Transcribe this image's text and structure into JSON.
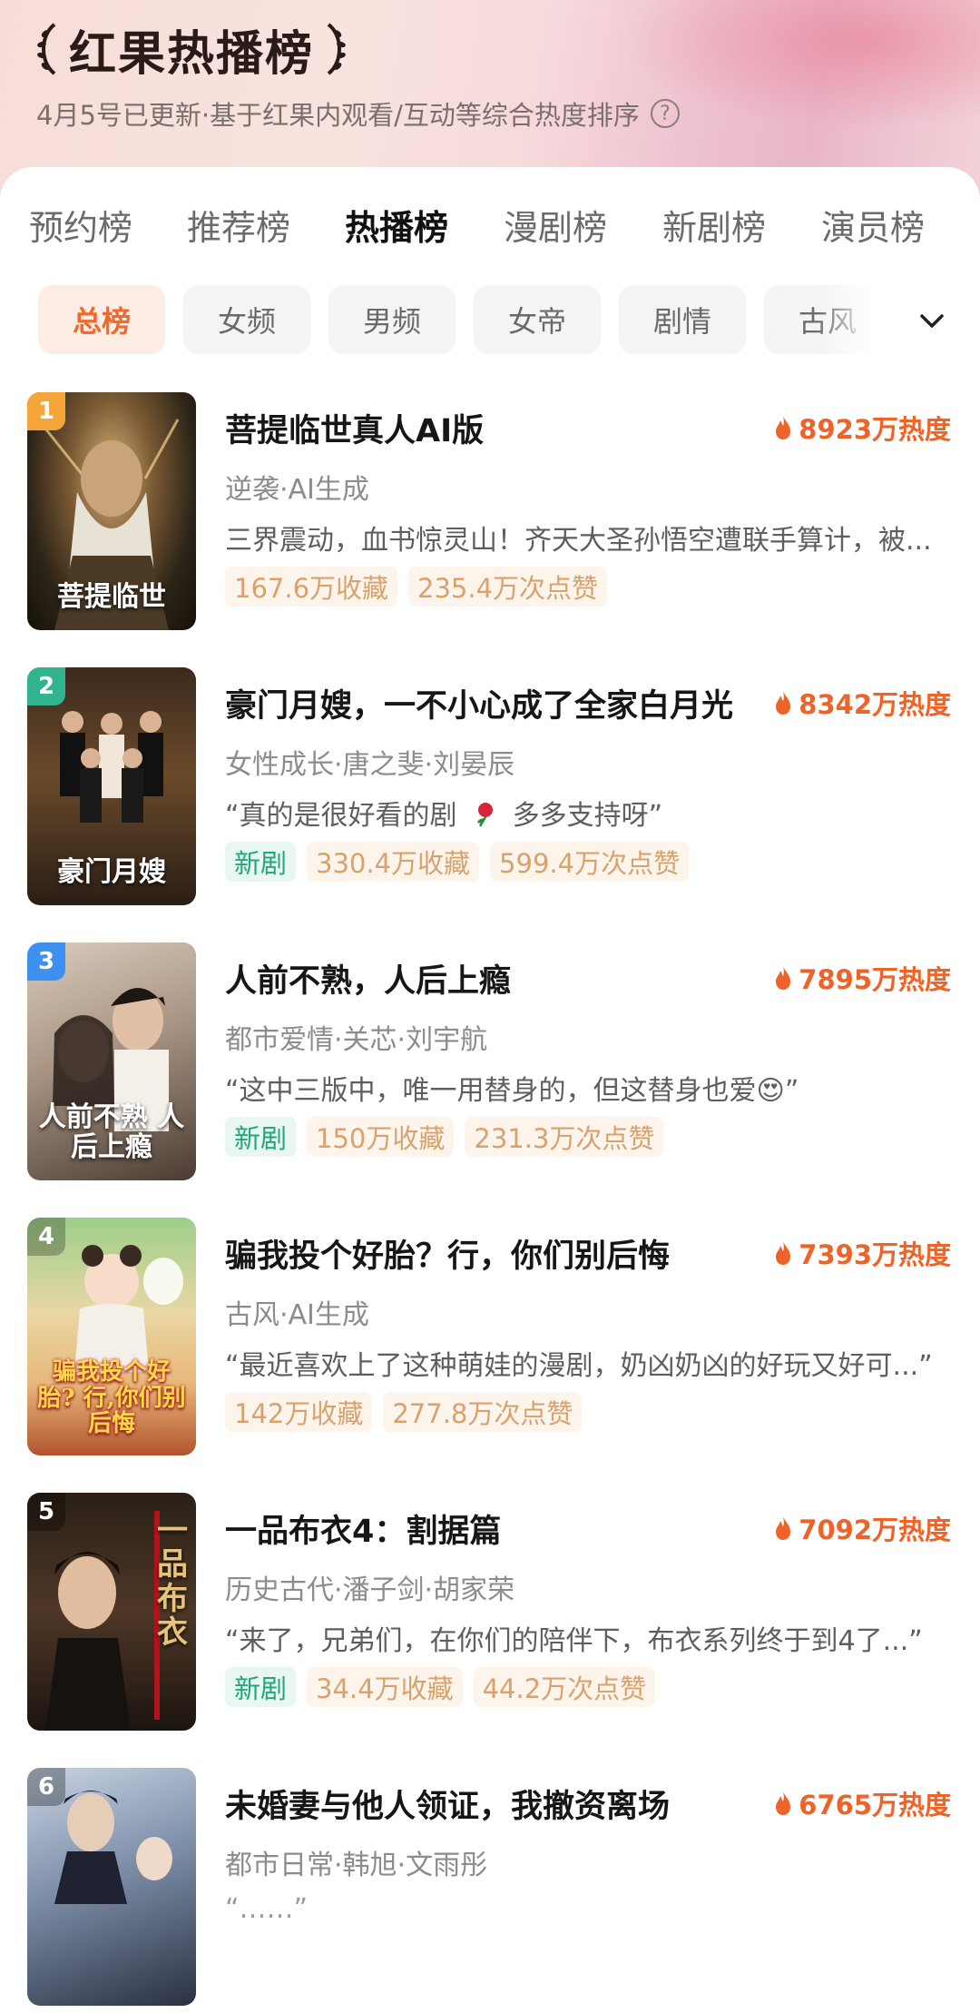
{
  "header": {
    "title": "红果热播榜",
    "subtitle": "4月5号已更新·基于红果内观看/互动等综合热度排序",
    "help_icon": "question-circle-icon"
  },
  "tabs": [
    "预约榜",
    "推荐榜",
    "热播榜",
    "漫剧榜",
    "新剧榜",
    "演员榜"
  ],
  "active_tab": "热播榜",
  "chips": [
    "总榜",
    "女频",
    "男频",
    "女帝",
    "剧情",
    "古风"
  ],
  "active_chip": "总榜",
  "colors": {
    "accent": "#ee6327",
    "new_badge": "#23a67a",
    "badge_text": "#d9a26c"
  },
  "items": [
    {
      "rank": "1",
      "poster_title": "菩提临世",
      "title": "菩提临世真人AI版",
      "heat": "8923万热度",
      "tags": "逆袭·AI生成",
      "desc": "三界震动，血书惊灵山！齐天大圣孙悟空遭联手算计，被...",
      "is_new": false,
      "new_label": "",
      "favorites": "167.6万收藏",
      "likes": "235.4万次点赞"
    },
    {
      "rank": "2",
      "poster_title": "豪门月嫂",
      "title": "豪门月嫂，一不小心成了全家白月光",
      "heat": "8342万热度",
      "tags": "女性成长·唐之斐·刘晏辰",
      "desc_pre": "“真的是很好看的剧",
      "desc_post": "多多支持呀”",
      "is_new": true,
      "new_label": "新剧",
      "favorites": "330.4万收藏",
      "likes": "599.4万次点赞"
    },
    {
      "rank": "3",
      "poster_title": "人前不熟 人后上瘾",
      "title": "人前不熟，人后上瘾",
      "heat": "7895万热度",
      "tags": "都市爱情·关芯·刘宇航",
      "desc": "“这中三版中，唯一用替身的，但这替身也爱😍”",
      "is_new": true,
      "new_label": "新剧",
      "favorites": "150万收藏",
      "likes": "231.3万次点赞"
    },
    {
      "rank": "4",
      "poster_title": "骗我投个好胎? 行,你们别后悔",
      "title": "骗我投个好胎？行，你们别后悔",
      "heat": "7393万热度",
      "tags": "古风·AI生成",
      "desc": "“最近喜欢上了这种萌娃的漫剧，奶凶奶凶的好玩又好可...”",
      "is_new": false,
      "new_label": "",
      "favorites": "142万收藏",
      "likes": "277.8万次点赞"
    },
    {
      "rank": "5",
      "poster_title": "一品布衣",
      "title": "一品布衣4：割据篇",
      "heat": "7092万热度",
      "tags": "历史古代·潘子剑·胡家荣",
      "desc": "“来了，兄弟们，在你们的陪伴下，布衣系列终于到4了...”",
      "is_new": true,
      "new_label": "新剧",
      "favorites": "34.4万收藏",
      "likes": "44.2万次点赞"
    },
    {
      "rank": "6",
      "poster_title": "",
      "title": "未婚妻与他人领证，我撤资离场",
      "heat": "6765万热度",
      "tags": "都市日常·韩旭·文雨彤",
      "desc": "“……”",
      "is_new": false,
      "new_label": "",
      "favorites": "",
      "likes": ""
    }
  ]
}
